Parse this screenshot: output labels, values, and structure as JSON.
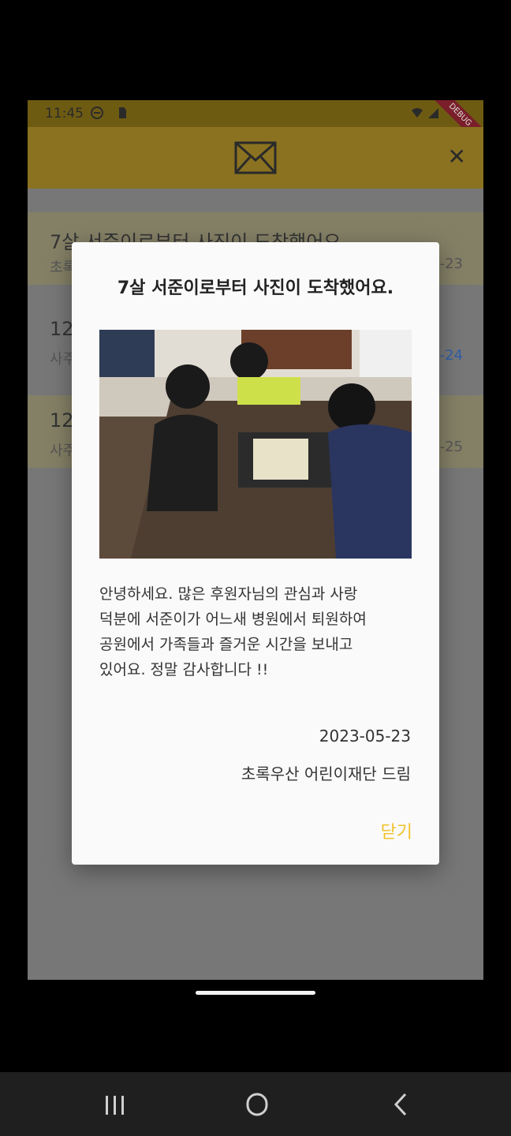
{
  "status_bar": {
    "time": "11:45",
    "debug_label": "DEBUG"
  },
  "app_bar": {
    "mail_icon": "envelope-icon",
    "close_icon": "close-icon",
    "close_glyph": "✕"
  },
  "messages": [
    {
      "title": "7살 서준이로부터 사진이 도착했어요",
      "subtitle": "초록",
      "date": "-23",
      "highlighted": true
    },
    {
      "title": "12",
      "subtitle": "사주",
      "date": "-24",
      "highlighted": false
    },
    {
      "title": "12",
      "subtitle": "사주",
      "date": "-25",
      "highlighted": true
    }
  ],
  "dialog": {
    "title": "7살 서준이로부터 사진이 도착했어요.",
    "body": "안녕하세요. 많은 후원자님의 관심과 사랑\n덕분에 서준이가 어느새 병원에서 퇴원하여\n공원에서 가족들과 즐거운 시간을 보내고\n있어요. 정말 감사합니다 !!",
    "date": "2023-05-23",
    "sender": "초록우산 어린이재단 드림",
    "close_label": "닫기"
  },
  "nav_bar": {
    "recents_icon": "recents-icon",
    "home_icon": "home-icon",
    "back_icon": "back-icon"
  },
  "colors": {
    "accent": "#f0c32b",
    "app_bar": "#8a7220",
    "dim_overlay": "#777777"
  }
}
